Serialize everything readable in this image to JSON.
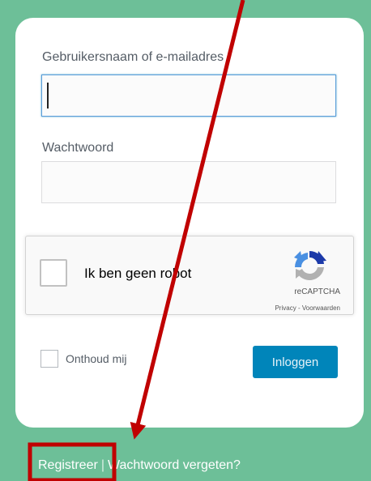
{
  "login_form": {
    "username_label": "Gebruikersnaam of e-mailadres",
    "username_value": "",
    "password_label": "Wachtwoord",
    "password_value": ""
  },
  "recaptcha": {
    "checkbox_label": "Ik ben geen robot",
    "brand": "reCAPTCHA",
    "privacy_link": "Privacy",
    "separator": "-",
    "terms_link": "Voorwaarden",
    "logo_icon": "recaptcha-logo-icon",
    "logo_colors": [
      "#1c3aa9",
      "#4a90e2",
      "#b1b1b1"
    ]
  },
  "remember": {
    "label": "Onthoud mij",
    "checked": false
  },
  "login_button": {
    "label": "Inloggen"
  },
  "bottom_nav": {
    "register_link": "Registreer",
    "separator": "|",
    "lost_password_link": "Wachtwoord vergeten?"
  },
  "annotation": {
    "arrow_color": "#c00000",
    "highlight_box_color": "#c00000"
  },
  "colors": {
    "page_background": "#6dbf98",
    "button": "#0085ba",
    "input_focus": "#5b9dd9"
  }
}
